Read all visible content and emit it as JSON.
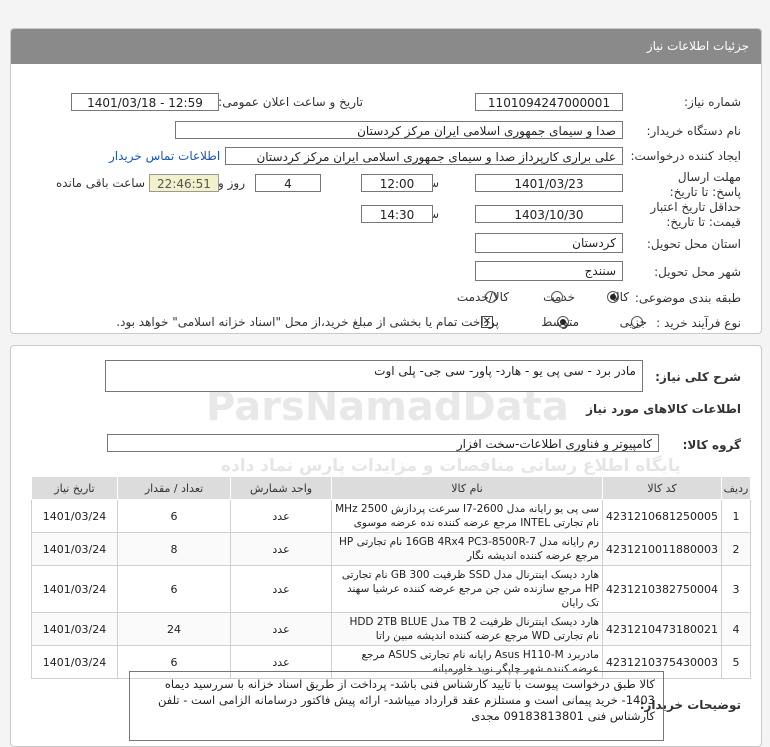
{
  "page": {
    "title": "جزئیات اطلاعات نیاز"
  },
  "form": {
    "need_number_label": "شماره نیاز:",
    "need_number": "1101094247000001",
    "announce_label": "تاریخ و ساعت اعلان عمومی:",
    "announce_value": "1401/03/18 - 12:59",
    "buyer_label": "نام دستگاه خریدار:",
    "buyer_value": "صدا و سیمای جمهوری اسلامی ایران مرکز کردستان",
    "creator_label": "ایجاد کننده درخواست:",
    "creator_value": "علی براری کارپرداز صدا و سیمای جمهوری اسلامی ایران مرکز کردستان",
    "contact_link": "اطلاعات تماس خریدار",
    "deadline_label": "مهلت ارسال پاسخ: تا تاریخ:",
    "deadline_date": "1401/03/23",
    "time_label": "ساعت",
    "deadline_time": "12:00",
    "days_value": "4",
    "days_label": "روز و",
    "remaining_time": "22:46:51",
    "remaining_label": "ساعت باقی مانده",
    "validity_label": "حداقل تاریخ اعتبار قیمت: تا تاریخ:",
    "validity_date": "1403/10/30",
    "validity_time_label": "ساعت",
    "validity_time": "14:30",
    "province_label": "استان محل تحویل:",
    "province_value": "کردستان",
    "city_label": "شهر محل تحویل:",
    "city_value": "سنندج",
    "category_label": "طبقه بندی موضوعی:",
    "category_options": [
      "کالا",
      "خدمت",
      "کالا/خدمت"
    ],
    "category_selected": "کالا",
    "process_label": "نوع فرآیند خرید :",
    "process_options": [
      "جزیی",
      "متوسط"
    ],
    "process_selected": "متوسط",
    "payment_note": "پرداخت تمام یا بخشی از مبلغ خرید،از محل \"اسناد خزانه اسلامی\" خواهد بود."
  },
  "details": {
    "summary_label": "شرح کلی نیاز:",
    "summary_value": "مادر برد - سی پی یو - هارد- پاور- سی جی- پلی اوت",
    "goods_info_header": "اطلاعات کالاهای مورد نیاز",
    "group_label": "گروه کالا:",
    "group_value": "کامپیوتر و فناوری اطلاعات-سخت افزار",
    "columns": [
      "ردیف",
      "کد کالا",
      "نام کالا",
      "واحد شمارش",
      "تعداد / مقدار",
      "تاریخ نیاز"
    ],
    "rows": [
      {
        "idx": "1",
        "code": "4231210681250005",
        "name": "سی پی یو رایانه مدل I7-2600 سرعت پردازش MHz 2500 نام تجارتی INTEL مرجع عرضه کننده نده عرضه موسوی",
        "unit": "عدد",
        "qty": "6",
        "date": "1401/03/24"
      },
      {
        "idx": "2",
        "code": "4231210011880003",
        "name": "رم رایانه مدل 16GB 4Rx4 PC3-8500R-7 نام تجارتی HP مرجع عرضه کننده اندیشه نگار",
        "unit": "عدد",
        "qty": "8",
        "date": "1401/03/24"
      },
      {
        "idx": "3",
        "code": "4231210382750004",
        "name": "هارد دیسک اینترنال مدل SSD ظرفیت GB 300 نام تجارتی HP مرجع سازنده شن جن مرجع عرضه کننده عرشیا سهند تک رایان",
        "unit": "عدد",
        "qty": "6",
        "date": "1401/03/24"
      },
      {
        "idx": "4",
        "code": "4231210473180021",
        "name": "هارد دیسک اینترنال ظرفیت TB 2 مدل HDD 2TB BLUE نام تجارتی WD مرجع عرضه کننده اندیشه مبین راتا",
        "unit": "عدد",
        "qty": "24",
        "date": "1401/03/24"
      },
      {
        "idx": "5",
        "code": "4231210375430003",
        "name": "مادربرد Asus H110-M رایانه نام تجارتی ASUS مرجع عرضه کننده شهر چاپگر نوید خاورمیانه",
        "unit": "عدد",
        "qty": "6",
        "date": "1401/03/24"
      }
    ],
    "notes_label": "توضیحات خریدار:",
    "notes_value": "کالا طبق درخواست پیوست  با تایید کارشناس فنی باشد- پرداخت از طریق اسناد خزانه با سررسید دیماه 1403- خرید پیمانی است و مستلزم عقد قرارداد میباشد- ارائه پیش فاکتور درسامانه الزامی است - تلفن کارشناس فنی 09183813801 مجدی"
  },
  "watermark": {
    "brand": "ParsNamadData",
    "tagline": "پایگاه اطلاع رسانی مناقصات و مزایدات پارس نماد داده"
  }
}
